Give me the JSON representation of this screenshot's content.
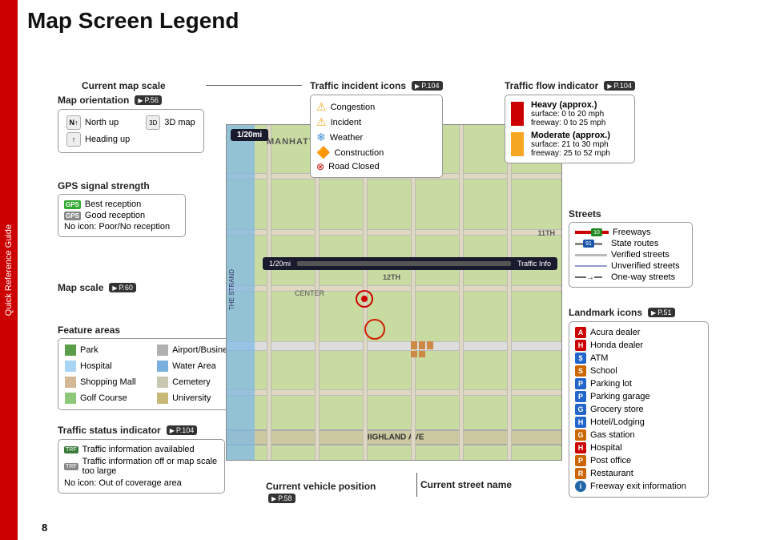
{
  "page": {
    "title": "Map Screen Legend",
    "number": "8",
    "side_tab": "Quick Reference Guide"
  },
  "sections": {
    "current_map_scale": "Current map scale",
    "map_orientation": "Map orientation",
    "map_orientation_ref": "P.56",
    "north_up": "North up",
    "three_d_map": "3D map",
    "heading_up": "Heading up",
    "gps_signal": "GPS signal strength",
    "gps_best": "Best reception",
    "gps_good": "Good reception",
    "gps_no": "No icon: Poor/No reception",
    "map_scale": "Map scale",
    "map_scale_ref": "P.60",
    "map_scale_value": "1/20mi",
    "feature_areas": "Feature areas",
    "traffic_status": "Traffic status indicator",
    "traffic_status_ref": "P.104",
    "traffic_avail": "Traffic information availabled",
    "traffic_off": "Traffic information off or map scale too large",
    "traffic_no": "No icon: Out of coverage area"
  },
  "traffic_icons": {
    "title": "Traffic incident icons",
    "ref": "P.104",
    "items": [
      {
        "label": "Congestion",
        "color": "#f5a623"
      },
      {
        "label": "Incident",
        "color": "#f5a623"
      },
      {
        "label": "Weather",
        "color": "#4a90d9"
      },
      {
        "label": "Construction",
        "color": "#e07b2a"
      },
      {
        "label": "Road Closed",
        "color": "#cc0000"
      }
    ]
  },
  "traffic_flow": {
    "title": "Traffic flow indicator",
    "ref": "P.104",
    "items": [
      {
        "label": "Heavy (approx.)",
        "sublabel": "surface: 0 to 20 mph\nfreeway: 0 to 25 mph",
        "color": "#cc0000"
      },
      {
        "label": "Moderate (approx.)",
        "sublabel": "surface: 21 to 30 mph\nfreeway: 25 to 52 mph",
        "color": "#f5a623"
      }
    ]
  },
  "streets": {
    "title": "Streets",
    "items": [
      {
        "label": "Freeways",
        "type": "freeway"
      },
      {
        "label": "State routes",
        "type": "state"
      },
      {
        "label": "Verified streets",
        "type": "verified"
      },
      {
        "label": "Unverified streets",
        "type": "unverified"
      },
      {
        "label": "One-way streets",
        "type": "oneway"
      }
    ]
  },
  "landmark_icons": {
    "title": "Landmark icons",
    "ref": "P.51",
    "items": [
      {
        "label": "Acura dealer",
        "bg": "#cc0000",
        "text": "A"
      },
      {
        "label": "Honda dealer",
        "bg": "#cc0000",
        "text": "H"
      },
      {
        "label": "ATM",
        "bg": "#2266cc",
        "text": "$"
      },
      {
        "label": "School",
        "bg": "#cc6600",
        "text": "S"
      },
      {
        "label": "Parking lot",
        "bg": "#2266cc",
        "text": "P"
      },
      {
        "label": "Parking garage",
        "bg": "#2266cc",
        "text": "P"
      },
      {
        "label": "Grocery store",
        "bg": "#2266cc",
        "text": "G"
      },
      {
        "label": "Hotel/Lodging",
        "bg": "#2266cc",
        "text": "H"
      },
      {
        "label": "Gas station",
        "bg": "#cc6600",
        "text": "G"
      },
      {
        "label": "Hospital",
        "bg": "#cc0000",
        "text": "H"
      },
      {
        "label": "Post office",
        "bg": "#cc6600",
        "text": "P"
      },
      {
        "label": "Restaurant",
        "bg": "#cc6600",
        "text": "R"
      },
      {
        "label": "Freeway exit information",
        "bg": "#2266aa",
        "text": "i"
      }
    ]
  },
  "feature_areas": {
    "items": [
      {
        "label": "Park",
        "color": "#5a9e4a"
      },
      {
        "label": "Hospital",
        "color": "#a8d4f5"
      },
      {
        "label": "Shopping Mall",
        "color": "#d4b896"
      },
      {
        "label": "Golf Course",
        "color": "#8cc878"
      },
      {
        "label": "Airport/Business",
        "color": "#c8c8c8"
      },
      {
        "label": "Water Area",
        "color": "#7ab0e0"
      },
      {
        "label": "Cemetery",
        "color": "#c8c8b0"
      },
      {
        "label": "University",
        "color": "#c8b878"
      }
    ]
  },
  "map_labels": {
    "street_name": "Current street name",
    "vehicle_pos": "Current vehicle position",
    "vehicle_pos_ref": "P.58",
    "highland": "HIGHLAND AVE",
    "manhattan_beach": "MANHATTAN BEACH",
    "center": "CENTER",
    "the_strand": "THE STRAND",
    "scale_display": "1/20mi",
    "traffic_info": "Traffic Info"
  }
}
